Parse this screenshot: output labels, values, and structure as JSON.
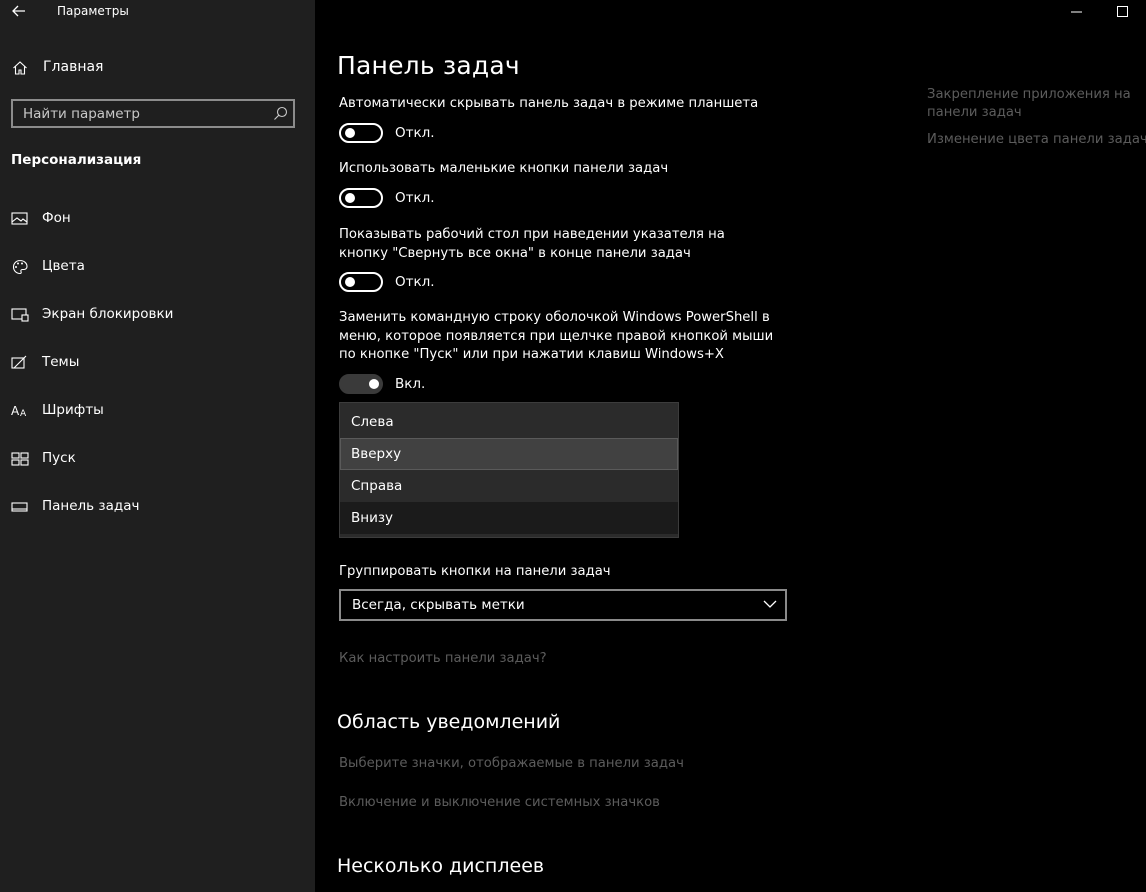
{
  "window": {
    "app_title": "Параметры",
    "back_icon": "back-arrow-icon",
    "minimize_icon": "minimize-icon",
    "maximize_icon": "maximize-icon"
  },
  "sidebar": {
    "home_label": "Главная",
    "search_placeholder": "Найти параметр",
    "section_title": "Персонализация",
    "items": [
      {
        "label": "Фон",
        "icon": "picture-icon"
      },
      {
        "label": "Цвета",
        "icon": "palette-icon"
      },
      {
        "label": "Экран блокировки",
        "icon": "lock-screen-icon"
      },
      {
        "label": "Темы",
        "icon": "themes-icon"
      },
      {
        "label": "Шрифты",
        "icon": "fonts-icon"
      },
      {
        "label": "Пуск",
        "icon": "start-icon"
      },
      {
        "label": "Панель задач",
        "icon": "taskbar-icon"
      }
    ]
  },
  "main": {
    "title": "Панель задач",
    "options": [
      {
        "label": "Автоматически скрывать панель задач в режиме планшета",
        "state": "Откл.",
        "on": false
      },
      {
        "label": "Использовать маленькие кнопки панели задач",
        "state": "Откл.",
        "on": false
      },
      {
        "label": "Показывать рабочий стол при наведении указателя на кнопку \"Свернуть все окна\" в конце панели задач",
        "state": "Откл.",
        "on": false
      },
      {
        "label": "Заменить командную строку оболочкой Windows PowerShell в меню, которое появляется при щелчке правой кнопкой мыши по кнопке \"Пуск\" или при нажатии клавиш Windows+X",
        "state": "Вкл.",
        "on": true
      }
    ],
    "position_dropdown": {
      "options": [
        "Слева",
        "Вверху",
        "Справа",
        "Внизу"
      ],
      "hovered": "Вверху",
      "selected": "Внизу"
    },
    "group_label": "Группировать кнопки на панели задач",
    "group_value": "Всегда, скрывать метки",
    "how_link": "Как настроить панели задач?",
    "notifications_title": "Область уведомлений",
    "notifications_links": [
      "Выберите значки, отображаемые в панели задач",
      "Включение и выключение системных значков"
    ],
    "multi_display_title": "Несколько дисплеев"
  },
  "related": {
    "links": [
      "Закрепление приложения на панели задач",
      "Изменение цвета панели задач"
    ]
  }
}
